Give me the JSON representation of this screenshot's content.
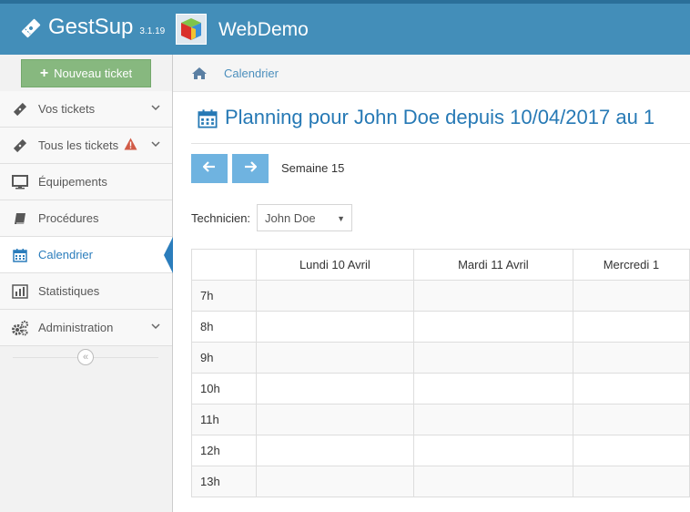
{
  "app": {
    "name": "GestSup",
    "version": "3.1.19",
    "company": "WebDemo",
    "brand_color": "#438eb9",
    "accent_color": "#2b7dbc"
  },
  "sidebar": {
    "new_ticket_label": "Nouveau ticket",
    "items": [
      {
        "label": "Vos tickets",
        "icon": "ticket-icon",
        "has_chevron": true
      },
      {
        "label": "Tous les tickets",
        "icon": "ticket-icon",
        "has_chevron": true,
        "badge": "warning-icon"
      },
      {
        "label": "Équipements",
        "icon": "monitor-icon"
      },
      {
        "label": "Procédures",
        "icon": "book-icon"
      },
      {
        "label": "Calendrier",
        "icon": "calendar-icon",
        "active": true
      },
      {
        "label": "Statistiques",
        "icon": "bar-chart-icon"
      },
      {
        "label": "Administration",
        "icon": "cogs-icon",
        "has_chevron": true
      }
    ],
    "collapse_icon": "double-chevron-left-icon"
  },
  "breadcrumb": {
    "home_icon": "home-icon",
    "current": "Calendrier"
  },
  "page": {
    "title": "Planning pour John Doe depuis 10/04/2017 au 1",
    "title_icon": "calendar-icon"
  },
  "week_nav": {
    "prev_icon": "arrow-left-icon",
    "next_icon": "arrow-right-icon",
    "label": "Semaine 15"
  },
  "technician": {
    "label": "Technicien:",
    "selected": "John Doe"
  },
  "planning": {
    "columns": [
      "Lundi 10 Avril",
      "Mardi 11 Avril",
      "Mercredi 1"
    ],
    "hours": [
      "7h",
      "8h",
      "9h",
      "10h",
      "11h",
      "12h",
      "13h"
    ]
  }
}
